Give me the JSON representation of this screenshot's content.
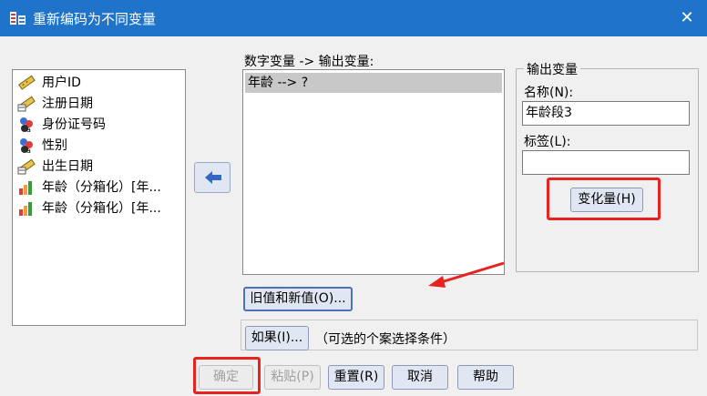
{
  "window": {
    "title": "重新编码为不同变量",
    "close_glyph": "✕"
  },
  "variables": [
    {
      "label": "用户ID",
      "icon": "ruler-scale-icon"
    },
    {
      "label": "注册日期",
      "icon": "ruler-date-icon"
    },
    {
      "label": "身份证号码",
      "icon": "nominal-string-icon"
    },
    {
      "label": "性别",
      "icon": "nominal-string-icon"
    },
    {
      "label": "出生日期",
      "icon": "ruler-date-icon"
    },
    {
      "label": "年龄（分箱化）[年...",
      "icon": "ordinal-bar-icon"
    },
    {
      "label": "年龄（分箱化）[年...",
      "icon": "ordinal-bar-icon"
    }
  ],
  "mapping": {
    "header": "数字变量 -> 输出变量:",
    "rows": [
      "年龄 --> ?"
    ]
  },
  "output_variable": {
    "legend": "输出变量",
    "name_label": "名称(N):",
    "name_value": "年龄段3",
    "label_label": "标签(L):",
    "label_value": "",
    "change_button": "变化量(H)"
  },
  "buttons": {
    "old_new_values": "旧值和新值(O)...",
    "if": "如果(I)...",
    "if_hint": "（可选的个案选择条件）",
    "ok": "确定",
    "paste": "粘贴(P)",
    "reset": "重置(R)",
    "cancel": "取消",
    "help": "帮助"
  },
  "colors": {
    "titlebar": "#1f73c8",
    "button_face": "#e1e7f2",
    "highlight_annotation": "#e8231f",
    "selected_row": "#c8c8c8"
  }
}
